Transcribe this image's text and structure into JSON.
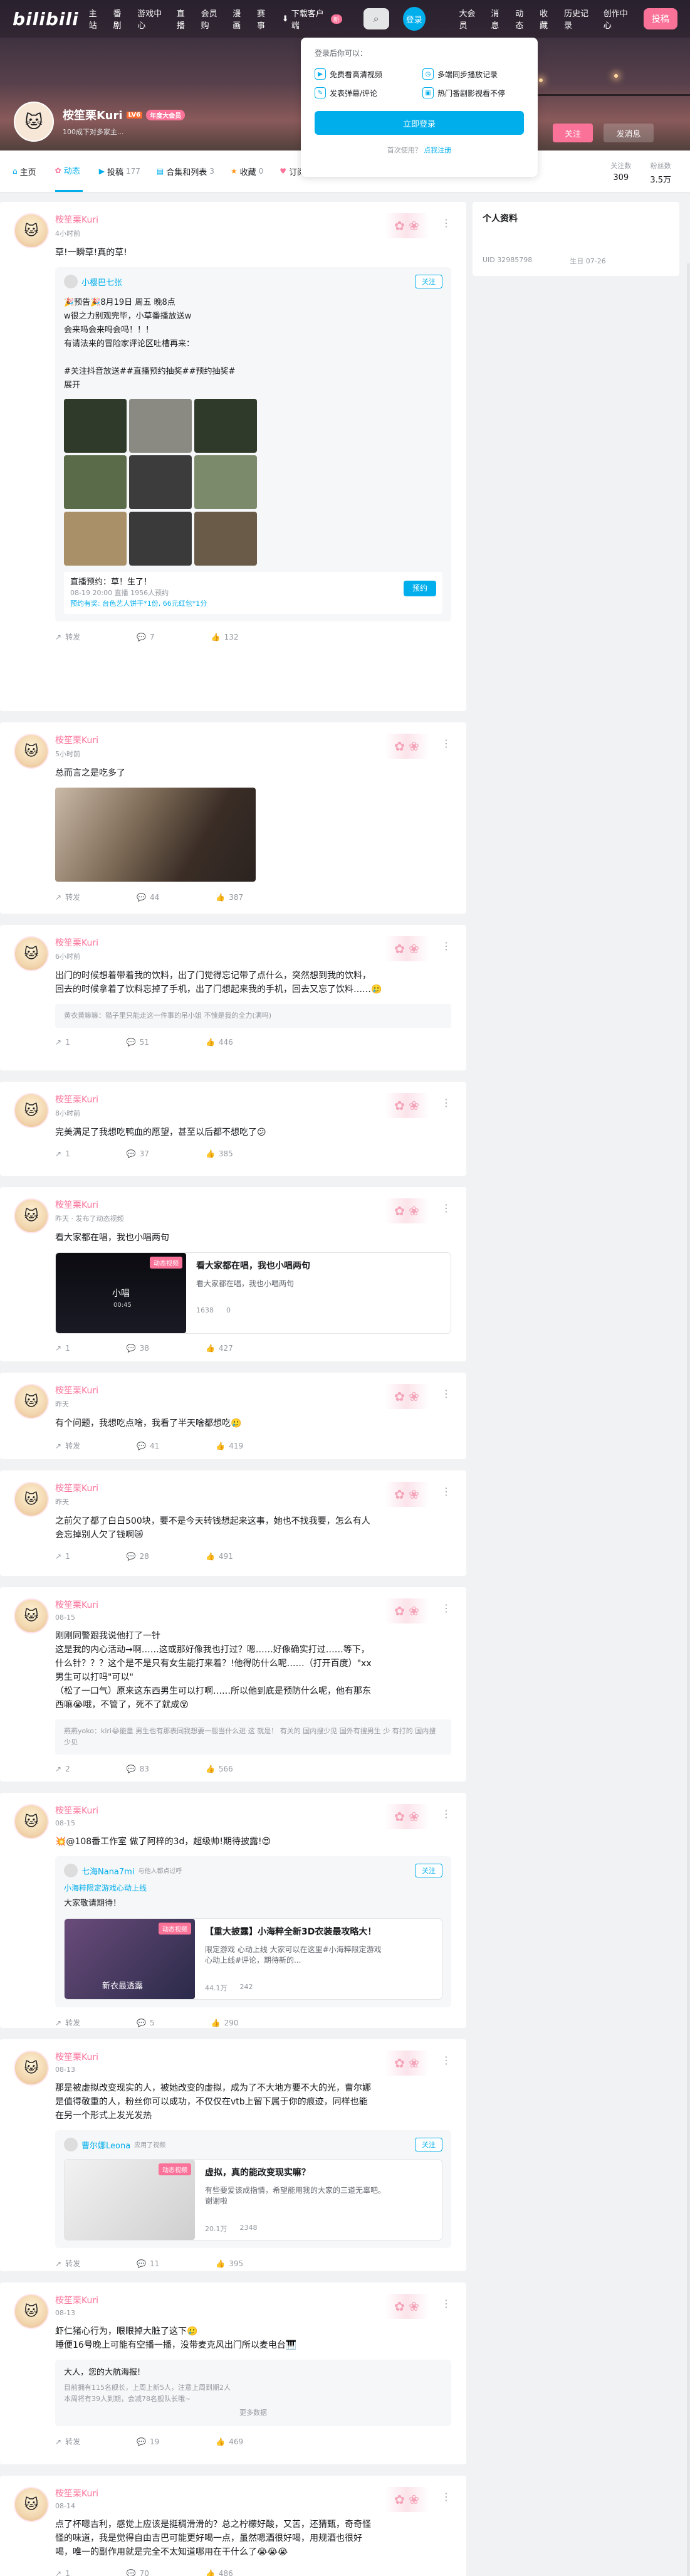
{
  "topbar": {
    "logo": "bilibili",
    "nav": [
      "主站",
      "番剧",
      "游戏中心",
      "直播",
      "会员购",
      "漫画",
      "赛事"
    ],
    "download": "下载客户端",
    "download_badge": "新",
    "avatar_label": "登录",
    "right_nav": [
      "大会员",
      "消息",
      "动态",
      "收藏",
      "历史记录",
      "创作中心"
    ],
    "upload": "投稿"
  },
  "profile": {
    "name": "桉笙栗Kuri",
    "level": "LV6",
    "vip": "年度大会员",
    "sign": "100成下对多家主...",
    "follow": "关注",
    "message": "发消息"
  },
  "tabs": [
    {
      "label": "主页",
      "count": ""
    },
    {
      "label": "动态",
      "count": ""
    },
    {
      "label": "投稿",
      "count": "177"
    },
    {
      "label": "合集和列表",
      "count": "3"
    },
    {
      "label": "收藏",
      "count": "0"
    },
    {
      "label": "订阅",
      "count": ""
    }
  ],
  "stats": [
    {
      "label": "关注数",
      "value": "309"
    },
    {
      "label": "粉丝数",
      "value": "3.5万"
    }
  ],
  "sidebar": {
    "title": "个人资料",
    "uid": "UID 32985798",
    "birthday": "生日 07-26"
  },
  "login_popup": {
    "title": "登录后你可以：",
    "features": [
      "免费看高清视频",
      "多端同步播放记录",
      "发表弹幕/评论",
      "热门番剧影视看不停"
    ],
    "login": "立即登录",
    "register_prompt": "首次使用？",
    "register_link": "点我注册"
  },
  "posts": [
    {
      "name": "桉笙栗Kuri",
      "time": "4小时前",
      "text": "草!一瞬草!真的草!",
      "forward": {
        "name": "小樱巴七张",
        "follow": "关注",
        "text": "🎉预告🎉8月19日 周五 晚8点\nw很之力别观完毕，小草番播放送w\n会来吗会来吗会吗！！！\n有请法来的冒险家评论区吐槽再来：\n\n#关注抖音放送##直播预约抽奖##预约抽奖#\n展开",
        "live_title": "直播预约：草！生了！",
        "live_meta": "08-19 20:00 直播  1956人预约",
        "live_prize": "预约有奖: 台色艺人饼干*1份, 66元红包*1分",
        "reserve": "预约"
      },
      "forward_count": "转发",
      "comments": "7",
      "likes": "132"
    },
    {
      "name": "桉笙栗Kuri",
      "time": "5小时前",
      "text": "总而言之是吃多了",
      "forward_count": "转发",
      "comments": "44",
      "likes": "387"
    },
    {
      "name": "桉笙栗Kuri",
      "time": "6小时前",
      "text": "出门的时候想着带着我的饮料，出了门觉得忘记带了点什么，突然想到我的饮料，\n回去的时候拿着了饮料忘掉了手机，出了门想起来我的手机，回去又忘了饮料……🥲",
      "reply": "黄衣黄嘛嘛：猫子里只能走这一件事的吊小姐 不愧是我的全力(满吗)",
      "forward_count": "1",
      "comments": "51",
      "likes": "446"
    },
    {
      "name": "桉笙栗Kuri",
      "time": "8小时前",
      "text": "完美满足了我想吃鸭血的愿望，甚至以后都不想吃了😕",
      "forward_count": "1",
      "comments": "37",
      "likes": "385"
    },
    {
      "name": "桉笙栗Kuri",
      "time": "昨天 · 发布了动态视频",
      "text": "看大家都在唱，我也小唱两句",
      "video": {
        "title": "看大家都在唱，我也小唱两句",
        "desc": "看大家都在唱，我也小唱两句",
        "thumb_label": "小唱",
        "duration": "00:45",
        "badge": "动态视频",
        "plays": "1638",
        "danmaku": "0"
      },
      "forward_count": "1",
      "comments": "38",
      "likes": "427"
    },
    {
      "name": "桉笙栗Kuri",
      "time": "昨天",
      "text": "有个问题，我想吃点啥，我看了半天啥都想吃🥲",
      "forward_count": "转发",
      "comments": "41",
      "likes": "419"
    },
    {
      "name": "桉笙栗Kuri",
      "time": "昨天",
      "text": "之前欠了都了白白500块，要不是今天转钱想起来这事，她也不找我要，怎么有人\n会忘掉别人欠了钱啊😿",
      "forward_count": "1",
      "comments": "28",
      "likes": "491"
    },
    {
      "name": "桉笙栗Kuri",
      "time": "08-15",
      "text": "刚刚同警跟我说他打了一针\n这是我的内心活动→啊……这或那好像我也打过？嗯……好像确实打过……等下，\n什么针？？？这个是不是只有女生能打来着？!他得防什么呢……（打开百度）\"xx\n男生可以打吗\"可以\"\n（松了一口气）原来这东西男生可以打啊……所以他到底是预防什么呢，他有那东\n西嘛😭哦，不管了，死不了就成😵",
      "reply": "燕燕yoko：kiri😂能量 男生也有那表同我想要一般当什么进 这 就是！\n有关的 国内搜少见 国外有搜男生 少 有打的 国内搜少见",
      "forward_count": "2",
      "comments": "83",
      "likes": "566"
    },
    {
      "name": "桉笙栗Kuri",
      "time": "08-15",
      "text": "💥@108番工作室 做了阿梓的3d，超级帅!期待披露!😍",
      "forward": {
        "name": "七海Nana7mi",
        "extra": "与他人都点过呼",
        "follow": "关注",
        "sub": "小海粹限定游戏心动上线",
        "text": "大家敬请期待！",
        "video_title": "【重大披露】小海粹全新3D衣装最攻略大！",
        "video_desc": "限定游戏 心动上线 大家可以在这里#小海粹限定游戏\n心动上线#评论，期待新的...",
        "badge": "动态视频",
        "thumb_label": "新衣最透露",
        "plays": "44.1万",
        "danmaku": "242"
      },
      "forward_count": "转发",
      "comments": "5",
      "likes": "290"
    },
    {
      "name": "桉笙栗Kuri",
      "time": "08-13",
      "text": "那是被虚拟改变现实的人，被她改变的虚拟，成为了不大地方要不大的光，曹尔娜\n是值得敬重的人，粉丝你可以成功，不仅仅在vtb上留下属于你的痕迹，同样也能\n在另一个形式上发光发热",
      "forward": {
        "name": "曹尔娜Leona",
        "extra": "应用了视频",
        "follow": "关注",
        "video_title": "虚拟，真的能改变现实嘛？",
        "video_desc": "有些要爱该成指情，希望能用我的大家的三道无辜吧。\n谢谢啦",
        "badge": "动态视频",
        "thumb_label": "",
        "plays": "20.1万",
        "danmaku": "2348"
      },
      "forward_count": "转发",
      "comments": "11",
      "likes": "395"
    },
    {
      "name": "桉笙栗Kuri",
      "time": "08-13",
      "text": "虾仁猪心行为，眼眼掉大脏了这下🥲\n睡便16号晚上可能有空播一播，没带麦克风出门所以麦电台🎹",
      "announce": {
        "title": "大人，您的大航海报!",
        "lines": [
          "目前拥有115名舰长，上周上新5人，注意上周到期2人",
          "本周将有39人到期，会减78名舰队长哦~"
        ],
        "more": "更多数据"
      },
      "forward_count": "转发",
      "comments": "19",
      "likes": "469"
    },
    {
      "name": "桉笙栗Kuri",
      "time": "08-14",
      "text": "点了杯嗯吉利，感觉上应该是挺稠滑滑的？总之柠檬好酸，又苦，还猜甄，奇奇怪\n怪的味道，我是觉得自由吉巴可能更好喝一点，虽然嗯酒很好喝，用规酒也很好\n喝，唯一的副作用就是完全不太知道哪用在干什么了😭😭😭",
      "forward_count": "1",
      "comments": "70",
      "likes": "486"
    }
  ]
}
